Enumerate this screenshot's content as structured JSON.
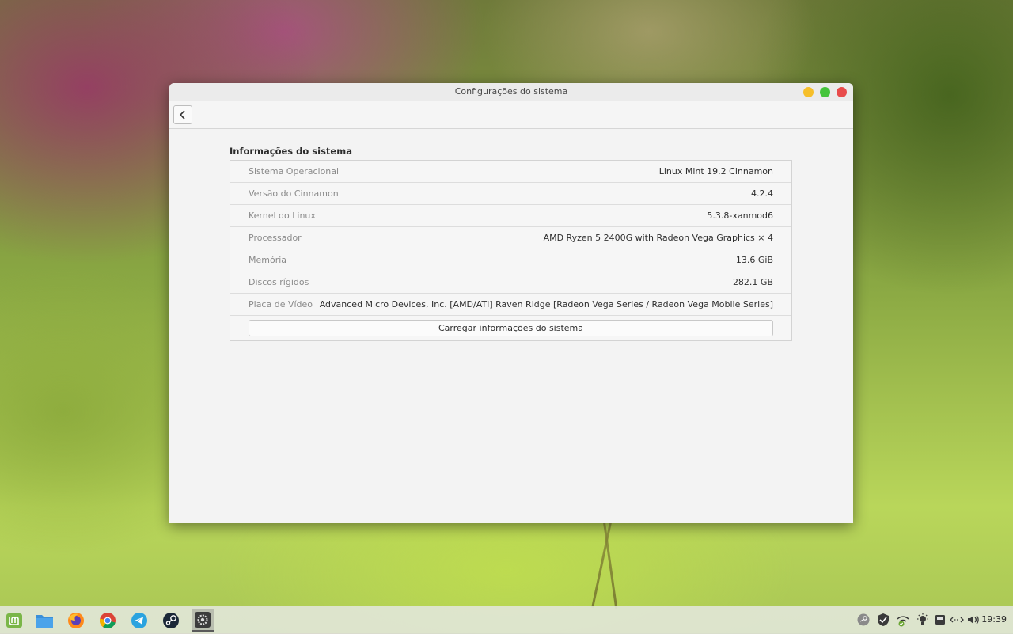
{
  "window": {
    "title": "Configurações do sistema"
  },
  "section": {
    "title": "Informações do sistema"
  },
  "info_rows": [
    {
      "label": "Sistema Operacional",
      "value": "Linux Mint 19.2 Cinnamon"
    },
    {
      "label": "Versão do Cinnamon",
      "value": "4.2.4"
    },
    {
      "label": "Kernel do Linux",
      "value": "5.3.8-xanmod6"
    },
    {
      "label": "Processador",
      "value": "AMD Ryzen 5 2400G with Radeon Vega Graphics × 4"
    },
    {
      "label": "Memória",
      "value": "13.6 GiB"
    },
    {
      "label": "Discos rígidos",
      "value": "282.1 GB"
    },
    {
      "label": "Placa de Vídeo",
      "value": "Advanced Micro Devices, Inc. [AMD/ATI] Raven Ridge [Radeon Vega Series / Radeon Vega Mobile Series]"
    }
  ],
  "load_button": {
    "label": "Carregar informações do sistema"
  },
  "taskbar": {
    "launchers": [
      "mint-menu-icon",
      "files-icon",
      "firefox-icon",
      "chrome-icon",
      "telegram-icon",
      "steam-icon",
      "settings-icon"
    ],
    "tray": [
      "steam-tray-icon",
      "shield-icon",
      "network-icon",
      "brightness-icon",
      "removable-drive-icon",
      "keyboard-icon",
      "volume-icon"
    ],
    "clock": "19:39"
  },
  "colors": {
    "accent_close": "#e84b4b",
    "accent_max": "#45c43b",
    "accent_min": "#f6bf2a",
    "mint_green": "#7ab648"
  }
}
